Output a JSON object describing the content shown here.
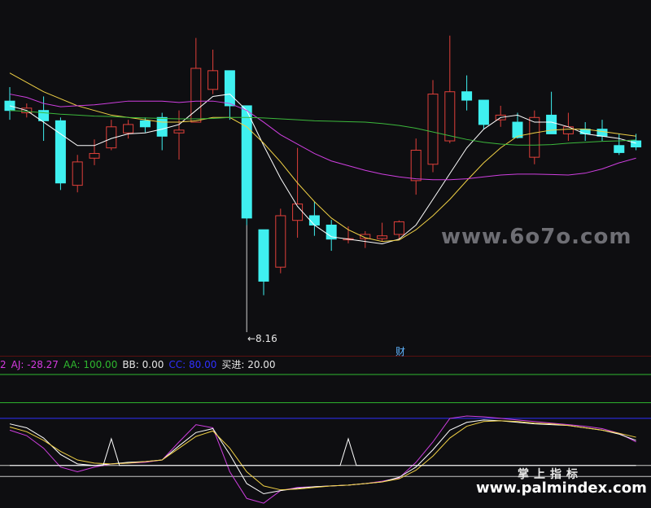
{
  "chart_data": [
    {
      "type": "candlestick",
      "panel": "main",
      "ylim": [
        6.5,
        12.8
      ],
      "x_count": 38,
      "min_label": "←8.16",
      "min_index": 14,
      "event_marker": {
        "index": 23,
        "label": "财"
      },
      "candles": [
        {
          "o": 11.3,
          "h": 11.6,
          "l": 10.9,
          "c": 11.1
        },
        {
          "o": 11.05,
          "h": 11.25,
          "l": 10.95,
          "c": 11.15
        },
        {
          "o": 11.1,
          "h": 11.4,
          "l": 10.45,
          "c": 10.88
        },
        {
          "o": 10.88,
          "h": 10.95,
          "l": 9.4,
          "c": 9.55
        },
        {
          "o": 9.5,
          "h": 10.15,
          "l": 9.35,
          "c": 10.0
        },
        {
          "o": 10.08,
          "h": 10.48,
          "l": 9.93,
          "c": 10.18
        },
        {
          "o": 10.3,
          "h": 10.9,
          "l": 10.25,
          "c": 10.75
        },
        {
          "o": 10.62,
          "h": 10.9,
          "l": 10.5,
          "c": 10.8
        },
        {
          "o": 10.88,
          "h": 10.95,
          "l": 10.63,
          "c": 10.75
        },
        {
          "o": 10.95,
          "h": 11.05,
          "l": 10.25,
          "c": 10.55
        },
        {
          "o": 10.62,
          "h": 11.1,
          "l": 10.05,
          "c": 10.68
        },
        {
          "o": 10.85,
          "h": 12.65,
          "l": 10.85,
          "c": 12.0
        },
        {
          "o": 11.55,
          "h": 12.4,
          "l": 11.45,
          "c": 11.95
        },
        {
          "o": 11.95,
          "h": 11.95,
          "l": 10.9,
          "c": 11.2
        },
        {
          "o": 11.2,
          "h": 11.2,
          "l": 8.65,
          "c": 8.8
        },
        {
          "o": 8.55,
          "h": 8.55,
          "l": 7.15,
          "c": 7.45
        },
        {
          "o": 7.75,
          "h": 9.0,
          "l": 7.62,
          "c": 8.85
        },
        {
          "o": 8.75,
          "h": 10.3,
          "l": 8.38,
          "c": 9.1
        },
        {
          "o": 8.85,
          "h": 9.15,
          "l": 8.42,
          "c": 8.65
        },
        {
          "o": 8.65,
          "h": 8.76,
          "l": 8.1,
          "c": 8.35
        },
        {
          "o": 8.35,
          "h": 8.62,
          "l": 8.26,
          "c": 8.36
        },
        {
          "o": 8.36,
          "h": 8.52,
          "l": 8.16,
          "c": 8.45
        },
        {
          "o": 8.36,
          "h": 8.7,
          "l": 8.3,
          "c": 8.42
        },
        {
          "o": 8.45,
          "h": 8.75,
          "l": 8.35,
          "c": 8.72
        },
        {
          "o": 9.6,
          "h": 10.5,
          "l": 9.3,
          "c": 10.25
        },
        {
          "o": 9.95,
          "h": 11.75,
          "l": 9.78,
          "c": 11.45
        },
        {
          "o": 10.45,
          "h": 12.7,
          "l": 10.4,
          "c": 11.5
        },
        {
          "o": 11.5,
          "h": 11.85,
          "l": 11.1,
          "c": 11.32
        },
        {
          "o": 11.32,
          "h": 11.32,
          "l": 10.7,
          "c": 10.8
        },
        {
          "o": 10.9,
          "h": 11.2,
          "l": 10.75,
          "c": 11.0
        },
        {
          "o": 10.85,
          "h": 11.05,
          "l": 10.5,
          "c": 10.52
        },
        {
          "o": 10.1,
          "h": 11.1,
          "l": 9.95,
          "c": 10.95
        },
        {
          "o": 11.0,
          "h": 11.5,
          "l": 10.6,
          "c": 10.6
        },
        {
          "o": 10.6,
          "h": 11.05,
          "l": 10.45,
          "c": 10.75
        },
        {
          "o": 10.7,
          "h": 10.85,
          "l": 10.45,
          "c": 10.6
        },
        {
          "o": 10.7,
          "h": 10.9,
          "l": 10.45,
          "c": 10.55
        },
        {
          "o": 10.35,
          "h": 10.6,
          "l": 10.15,
          "c": 10.2
        },
        {
          "o": 10.45,
          "h": 10.6,
          "l": 10.25,
          "c": 10.32
        }
      ],
      "lines": [
        {
          "color": "#ffffff",
          "values": [
            11.2,
            11.1,
            10.85,
            10.6,
            10.35,
            10.35,
            10.5,
            10.6,
            10.62,
            10.7,
            10.8,
            11.1,
            11.4,
            11.45,
            11.1,
            10.35,
            9.65,
            9.05,
            8.65,
            8.4,
            8.35,
            8.3,
            8.25,
            8.35,
            8.65,
            9.2,
            9.75,
            10.3,
            10.7,
            10.95,
            11.0,
            10.85,
            10.85,
            10.75,
            10.6,
            10.55,
            10.5,
            10.4
          ]
        },
        {
          "color": "#f0d045",
          "values": [
            11.9,
            11.7,
            11.5,
            11.35,
            11.2,
            11.1,
            11.0,
            10.95,
            10.9,
            10.85,
            10.85,
            10.88,
            10.95,
            10.95,
            10.75,
            10.4,
            10.0,
            9.55,
            9.15,
            8.8,
            8.55,
            8.38,
            8.3,
            8.33,
            8.55,
            8.85,
            9.2,
            9.6,
            9.98,
            10.3,
            10.55,
            10.62,
            10.68,
            10.7,
            10.7,
            10.65,
            10.6,
            10.55
          ]
        },
        {
          "color": "#cf3fe0",
          "values": [
            11.45,
            11.38,
            11.25,
            11.18,
            11.2,
            11.22,
            11.26,
            11.3,
            11.3,
            11.3,
            11.27,
            11.3,
            11.3,
            11.25,
            11.1,
            10.85,
            10.58,
            10.38,
            10.18,
            10.02,
            9.92,
            9.82,
            9.74,
            9.68,
            9.64,
            9.62,
            9.62,
            9.64,
            9.68,
            9.72,
            9.74,
            9.74,
            9.73,
            9.72,
            9.76,
            9.85,
            9.98,
            10.08
          ]
        },
        {
          "color": "#3cb83c",
          "values": [
            11.1,
            11.08,
            11.05,
            11.02,
            11.0,
            10.98,
            10.97,
            10.95,
            10.94,
            10.93,
            10.92,
            10.92,
            10.93,
            10.95,
            10.95,
            10.94,
            10.92,
            10.9,
            10.88,
            10.87,
            10.86,
            10.85,
            10.82,
            10.78,
            10.72,
            10.64,
            10.56,
            10.48,
            10.42,
            10.38,
            10.36,
            10.36,
            10.37,
            10.4,
            10.42,
            10.44,
            10.45,
            10.47
          ]
        }
      ]
    },
    {
      "type": "line",
      "panel": "indicator",
      "ylim": [
        -30,
        110
      ],
      "legend": [
        {
          "text": "2",
          "color": "#d43ae0"
        },
        {
          "text": "AJ: -28.27",
          "color": "#d43ae0"
        },
        {
          "text": "AA: 100.00",
          "color": "#2fb82f"
        },
        {
          "text": "BB: 0.00",
          "color": "#e6e6e6"
        },
        {
          "text": "CC: 80.00",
          "color": "#3030ff"
        },
        {
          "text": "买进: 20.00",
          "color": "#e6e6e6"
        }
      ],
      "hlines": [
        {
          "value": 100,
          "color": "#2fb82f"
        },
        {
          "value": 80,
          "color": "#3030ff"
        },
        {
          "value": 20,
          "color": "#c8c8c8"
        },
        {
          "value": 6,
          "color": "#c8c8c8"
        }
      ],
      "series": [
        {
          "color": "#cf3fe0",
          "values": [
            65,
            58,
            42,
            18,
            12,
            18,
            22,
            23,
            24,
            27,
            50,
            72,
            68,
            12,
            -22,
            -28,
            -12,
            -8,
            -7,
            -6,
            -5,
            -3,
            0,
            4,
            24,
            50,
            80,
            83,
            82,
            80,
            78,
            76,
            74,
            72,
            70,
            67,
            61,
            50
          ]
        },
        {
          "color": "#ffffff",
          "values": [
            73,
            68,
            55,
            34,
            22,
            20,
            22,
            24,
            25,
            27,
            45,
            62,
            67,
            34,
            -3,
            -16,
            -12,
            -9,
            -7,
            -6,
            -5,
            -3,
            -1,
            5,
            18,
            40,
            65,
            75,
            78,
            77,
            75,
            73,
            72,
            71,
            68,
            65,
            60,
            52
          ]
        },
        {
          "color": "#f0d045",
          "values": [
            69,
            63,
            52,
            38,
            27,
            23,
            22,
            23,
            25,
            27,
            42,
            57,
            64,
            42,
            12,
            -6,
            -11,
            -10,
            -8,
            -6,
            -5,
            -3,
            -1,
            3,
            14,
            32,
            55,
            70,
            76,
            77,
            76,
            74,
            73,
            71,
            68,
            65,
            61,
            56
          ]
        },
        {
          "color": "#ffffff",
          "values": [
            20,
            20,
            20,
            20,
            20,
            20,
            20,
            20,
            20,
            20,
            20,
            20,
            20,
            20,
            20,
            20,
            20,
            20,
            20,
            20,
            20,
            20,
            20,
            20,
            20,
            20,
            20,
            20,
            20,
            20,
            20,
            20,
            20,
            20,
            20,
            20,
            20,
            20
          ],
          "spikes": [
            {
              "index": 6,
              "value": 54
            },
            {
              "index": 20,
              "value": 54
            }
          ]
        }
      ]
    }
  ],
  "watermarks": {
    "site_a": "www.6o7o.com",
    "site_b_cn": "掌上指标",
    "site_b": "www.palmindex.com"
  }
}
